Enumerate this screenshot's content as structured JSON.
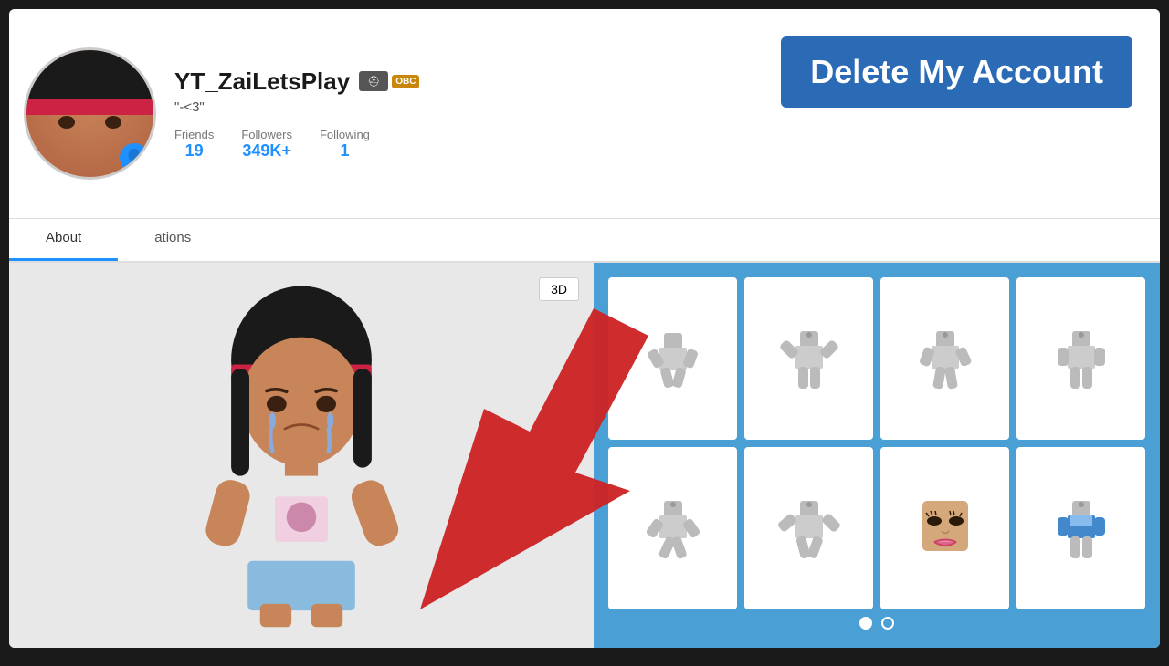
{
  "window": {
    "dots": [
      "dot1",
      "dot2",
      "dot3"
    ]
  },
  "profile": {
    "username": "YT_ZaiLetsPlay",
    "status": "\"-<3\"",
    "stats": {
      "friends_label": "Friends",
      "friends_value": "19",
      "followers_label": "Followers",
      "followers_value": "349K+",
      "following_label": "Following",
      "following_value": "1"
    }
  },
  "delete_banner": {
    "text": "Delete My Account"
  },
  "tabs": [
    {
      "label": "About",
      "active": true
    },
    {
      "label": "ations",
      "active": false
    }
  ],
  "view_3d_button": "3D",
  "inventory": {
    "items": [
      {
        "id": 1,
        "pose": "running"
      },
      {
        "id": 2,
        "pose": "arms-up"
      },
      {
        "id": 3,
        "pose": "waving"
      },
      {
        "id": 4,
        "pose": "standing"
      },
      {
        "id": 5,
        "pose": "crouching"
      },
      {
        "id": 6,
        "pose": "gesturing"
      },
      {
        "id": 7,
        "pose": "face"
      },
      {
        "id": 8,
        "pose": "shirt"
      }
    ],
    "pagination": {
      "current": 1,
      "total": 2
    }
  }
}
